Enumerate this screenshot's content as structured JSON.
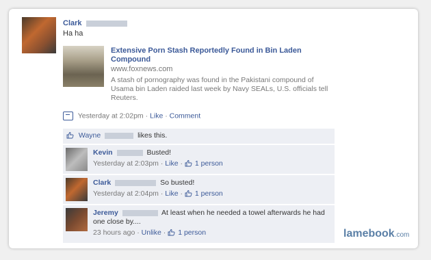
{
  "post": {
    "author": "Clark",
    "status": "Ha ha",
    "link": {
      "title": "Extensive Porn Stash Reportedly Found in Bin Laden Compound",
      "url": "www.foxnews.com",
      "description": "A stash of pornography was found in the Pakistani compound of Usama bin Laden raided last week by Navy SEALs, U.S. officials tell Reuters."
    },
    "meta": {
      "time": "Yesterday at 2:02pm",
      "like": "Like",
      "comment": "Comment",
      "sep": "·"
    }
  },
  "likes": {
    "name": "Wayne",
    "suffix": "likes this."
  },
  "comments": [
    {
      "name": "Kevin",
      "text": "Busted!",
      "time": "Yesterday at 2:03pm",
      "action": "Like",
      "count": "1 person"
    },
    {
      "name": "Clark",
      "text": "So busted!",
      "time": "Yesterday at 2:04pm",
      "action": "Like",
      "count": "1 person"
    },
    {
      "name": "Jeremy",
      "text": "At least when he needed a towel afterwards he had one close by....",
      "time": "23 hours ago",
      "action": "Unlike",
      "count": "1 person"
    }
  ],
  "brand": {
    "main": "lamebook",
    "suffix": ".com"
  },
  "colors": {
    "link": "#3b5998",
    "box_bg": "#edeff4",
    "muted": "#777777"
  },
  "icons": [
    "post-icon",
    "thumbs-up-icon"
  ]
}
